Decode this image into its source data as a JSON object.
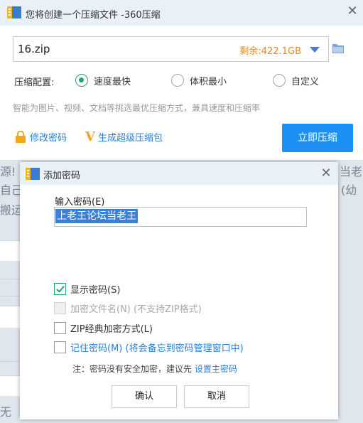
{
  "window": {
    "title": "您将创建一个压缩文件 -360压缩",
    "close_glyph": "✕"
  },
  "path": {
    "value": "16.zip",
    "free_space": "剩余:422.1GB"
  },
  "config": {
    "label": "压缩配置:",
    "options": [
      {
        "label": "速度最快",
        "selected": true
      },
      {
        "label": "体积最小",
        "selected": false
      },
      {
        "label": "自定义",
        "selected": false
      }
    ],
    "hint": "智能为图片、视频、文档等挑选最优压缩方式，兼具速度和压缩率"
  },
  "actions": {
    "change_password": "修改密码",
    "super_package": "生成超级压缩包",
    "compress_now": "立即压缩"
  },
  "background_fragments": {
    "left_1": "源!",
    "left_2": "自己",
    "left_3": "搬运",
    "right_1": "当老",
    "right_2": "(幼",
    "bottom": "无"
  },
  "dialog": {
    "title": "添加密码",
    "close_glyph": "✕",
    "password_label": "输入密码(E)",
    "password_value": "上老王论坛当老王",
    "checkboxes": [
      {
        "label": "显示密码(S)",
        "checked": true,
        "enabled": true
      },
      {
        "label": "加密文件名(N) (不支持ZIP格式)",
        "checked": false,
        "enabled": false
      },
      {
        "label": "ZIP经典加密方式(L)",
        "checked": false,
        "enabled": true
      },
      {
        "label": "记住密码(M) (将会备忘到密码管理窗口中)",
        "checked": false,
        "enabled": true
      }
    ],
    "note_prefix": "注：密码没有安全加密，建议先",
    "note_link": "设置主密码",
    "ok_label": "确认",
    "cancel_label": "取消"
  },
  "colors": {
    "accent": "#1c8ff5",
    "green": "#27a36d",
    "link": "#2a7fd2",
    "free_space": "#e08a22"
  }
}
